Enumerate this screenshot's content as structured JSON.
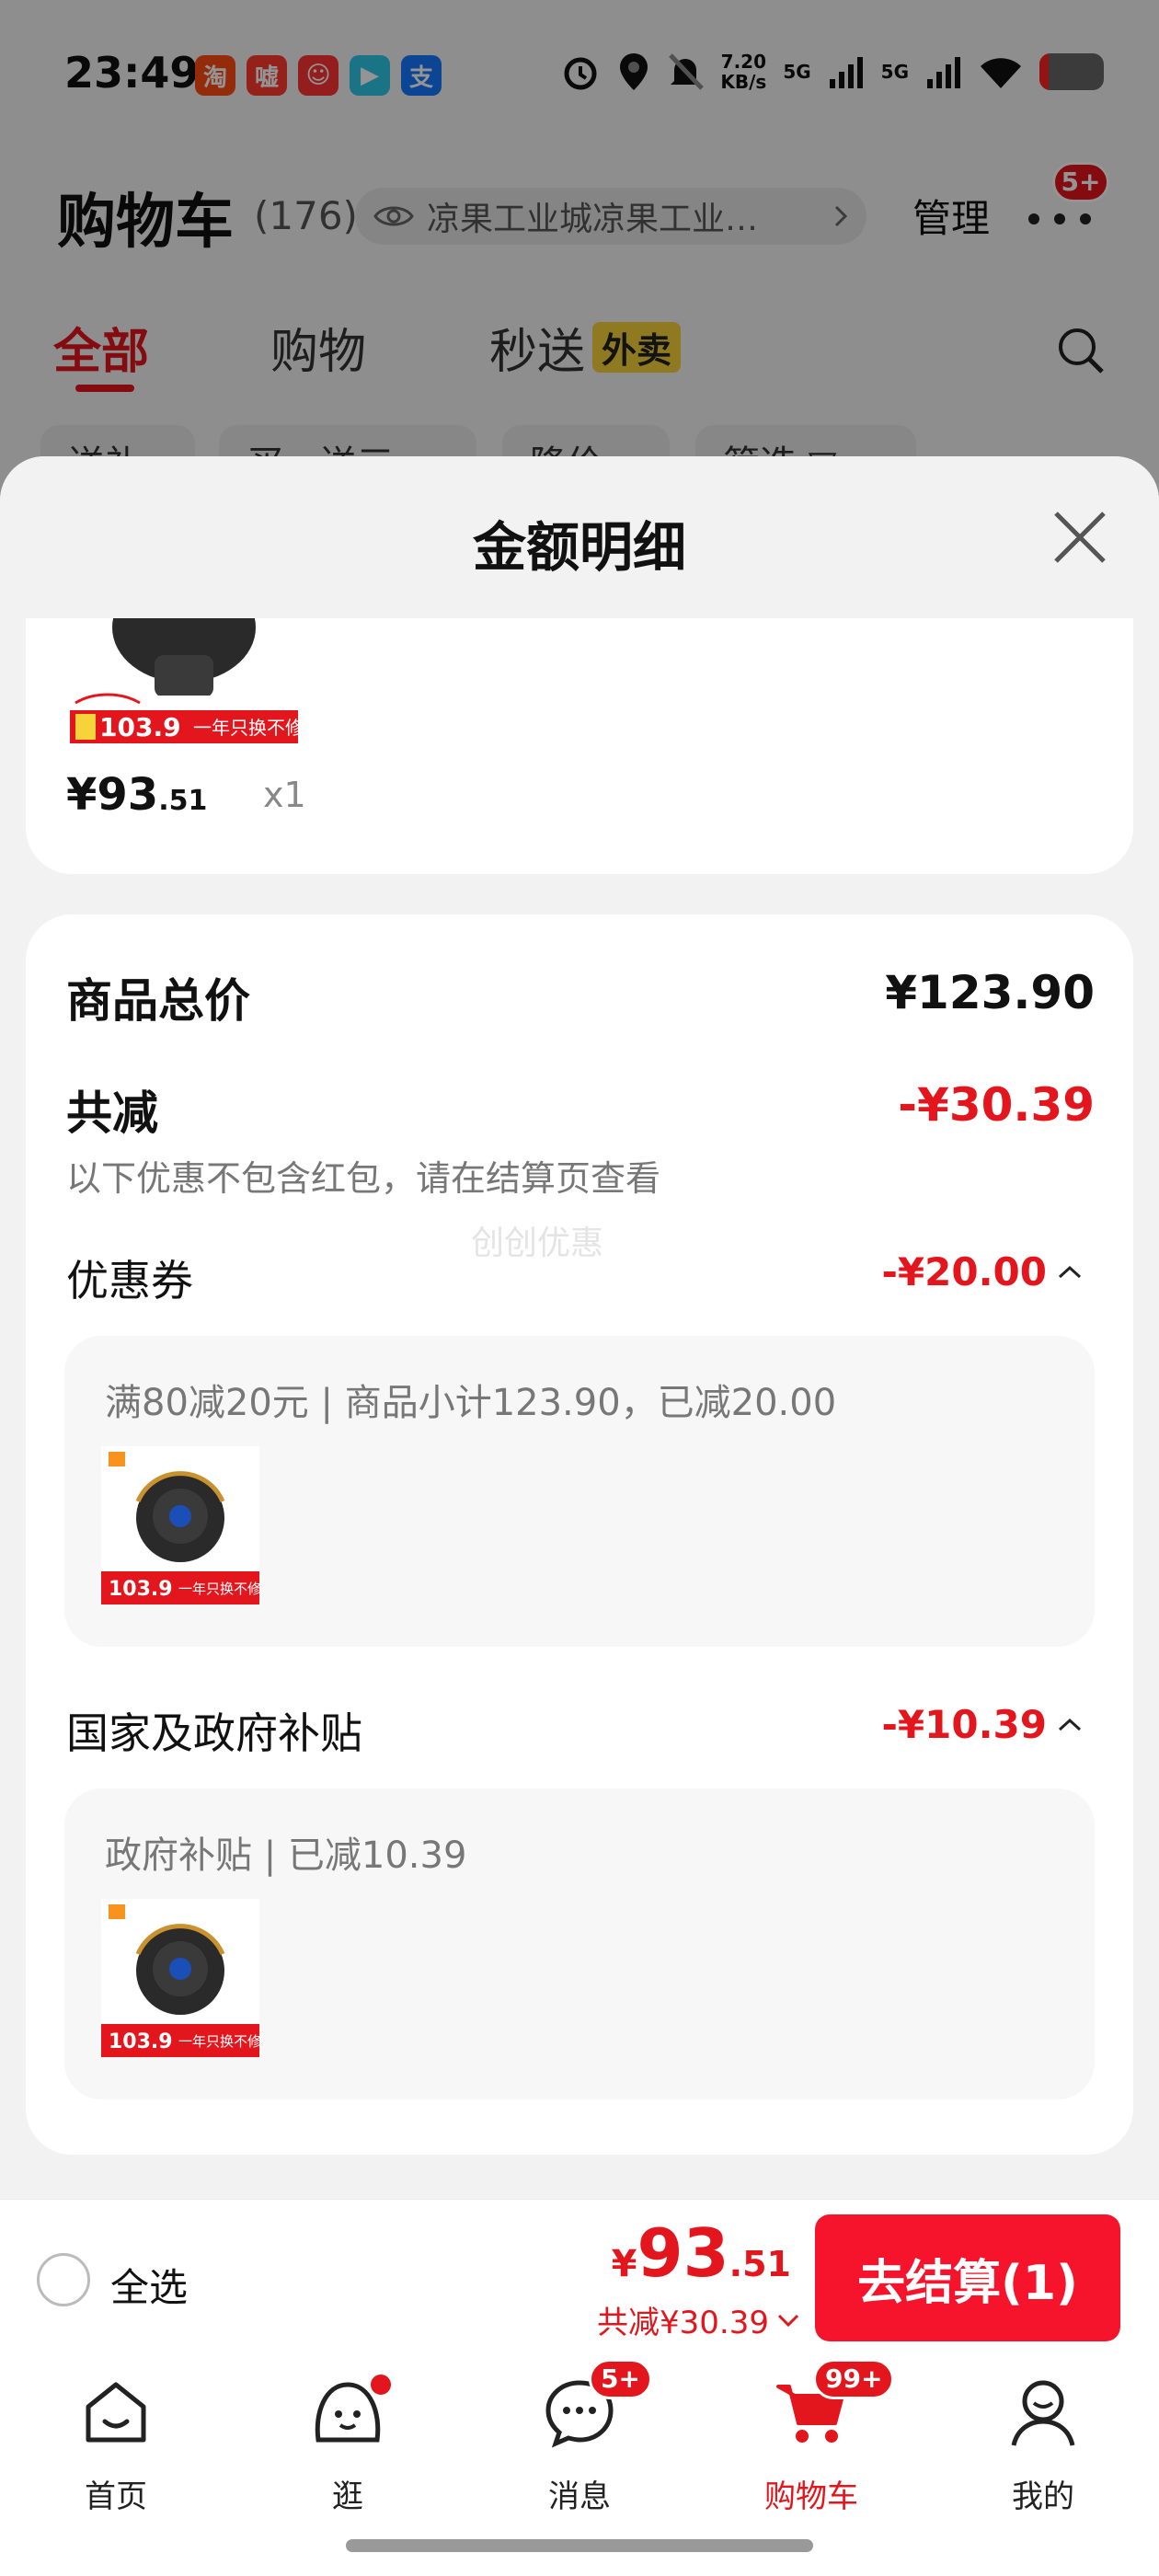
{
  "status_bar": {
    "time": "23:49",
    "app_icons": [
      {
        "name": "taobao-app-icon",
        "glyph": "淘",
        "color": "#ff4b12"
      },
      {
        "name": "mall-app-icon",
        "glyph": "嘘",
        "color": "#ff3b30"
      },
      {
        "name": "promo-app-icon",
        "glyph": "☺",
        "color": "#f33"
      },
      {
        "name": "video-app-icon",
        "glyph": "▶",
        "color": "#2ec8e6"
      },
      {
        "name": "alipay-app-icon",
        "glyph": "支",
        "color": "#1677ff"
      }
    ],
    "net_speed_value": "7.20",
    "net_speed_unit": "KB/s",
    "net_label_1": "5G",
    "net_label_2": "5G"
  },
  "cart_header": {
    "title": "购物车",
    "count": "(176)",
    "address": "凉果工业城凉果工业…",
    "manage_label": "管理",
    "more_badge": "5+"
  },
  "tabs": [
    {
      "label": "全部",
      "active": true
    },
    {
      "label": "购物",
      "active": false
    },
    {
      "label": "秒送",
      "active": false,
      "badge": "外卖"
    }
  ],
  "filter_chips": [
    "送礼",
    "买一送三",
    "降价",
    "筛选 ▽"
  ],
  "sheet": {
    "title": "金额明细",
    "product": {
      "price_int": "¥93",
      "price_dec": ".51",
      "qty": "x1",
      "banner_price": "103.9",
      "banner_slogan": "一年只换不修"
    },
    "summary": {
      "total_label": "商品总价",
      "total_value": "¥123.90",
      "discount_label": "共减",
      "discount_value": "-¥30.39",
      "hint": "以下优惠不包含红包，请在结算页查看",
      "watermark": "创创优惠"
    },
    "coupon": {
      "label": "优惠券",
      "value": "-¥20.00",
      "detail": "满80减20元 | 商品小计123.90，已减20.00"
    },
    "subsidy": {
      "label": "国家及政府补贴",
      "value": "-¥10.39",
      "detail": "政府补贴 | 已减10.39"
    }
  },
  "checkout": {
    "select_all_label": "全选",
    "currency": "¥",
    "total_int": "93",
    "total_dec": ".51",
    "saved_text": "共减¥30.39",
    "button_label": "去结算(1)"
  },
  "bottom_nav": [
    {
      "label": "首页",
      "icon": "home-icon"
    },
    {
      "label": "逛",
      "icon": "browse-icon",
      "dot": true
    },
    {
      "label": "消息",
      "icon": "message-icon",
      "badge": "5+"
    },
    {
      "label": "购物车",
      "icon": "cart-icon",
      "badge": "99+",
      "active": true
    },
    {
      "label": "我的",
      "icon": "profile-icon"
    }
  ],
  "colors": {
    "accent": "#e4161d",
    "checkout": "#f5142b",
    "waimai": "#f6d33a"
  }
}
